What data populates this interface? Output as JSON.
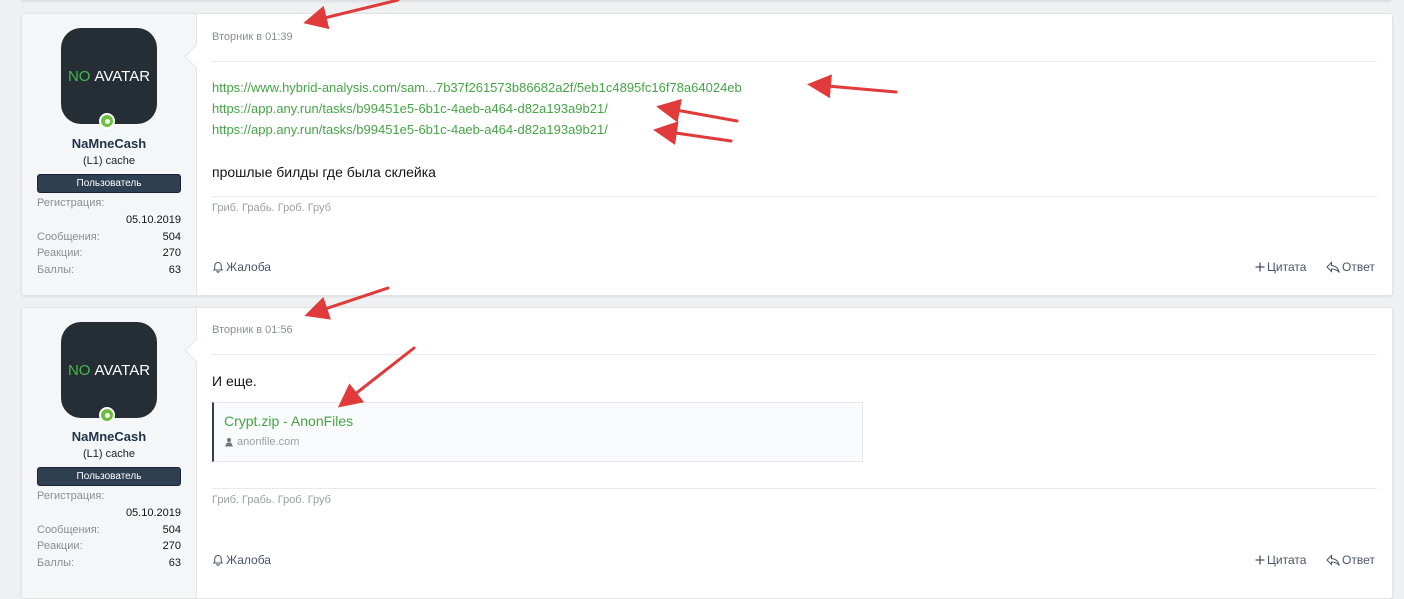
{
  "posts": [
    {
      "user": {
        "avatar_no": "NO",
        "avatar_text": "AVATAR",
        "name": "NaMneCash",
        "title": "(L1) cache",
        "banner": "Пользователь",
        "reg_label": "Регистрация:",
        "reg_date": "05.10.2019",
        "messages_label": "Сообщения:",
        "messages": "504",
        "reactions_label": "Реакции:",
        "reactions": "270",
        "points_label": "Баллы:",
        "points": "63"
      },
      "date": "Вторник в 01:39",
      "links": [
        "https://www.hybrid-analysis.com/sam...7b37f261573b86682a2f/5eb1c4895fc16f78a64024eb",
        "https://app.any.run/tasks/b99451e5-6b1c-4aeb-a464-d82a193a9b21/",
        "https://app.any.run/tasks/b99451e5-6b1c-4aeb-a464-d82a193a9b21/"
      ],
      "text": "прошлые билды где была склейка",
      "signature": "Гриб. Грабь. Гроб. Груб",
      "report": "Жалоба",
      "quote": "Цитата",
      "reply": "Ответ"
    },
    {
      "user": {
        "avatar_no": "NO",
        "avatar_text": "AVATAR",
        "name": "NaMneCash",
        "title": "(L1) cache",
        "banner": "Пользователь",
        "reg_label": "Регистрация:",
        "reg_date": "05.10.2019",
        "messages_label": "Сообщения:",
        "messages": "504",
        "reactions_label": "Реакции:",
        "reactions": "270",
        "points_label": "Баллы:",
        "points": "63"
      },
      "date": "Вторник в 01:56",
      "text": "И еще.",
      "embed": {
        "title": "Crypt.zip - AnonFiles",
        "domain": "anonfile.com"
      },
      "signature": "Гриб. Грабь. Гроб. Груб",
      "report": "Жалоба",
      "quote": "Цитата",
      "reply": "Ответ"
    }
  ],
  "colors": {
    "link": "#47a347",
    "banner": "#2f3f52",
    "annotation_arrow": "#e03a3a"
  }
}
